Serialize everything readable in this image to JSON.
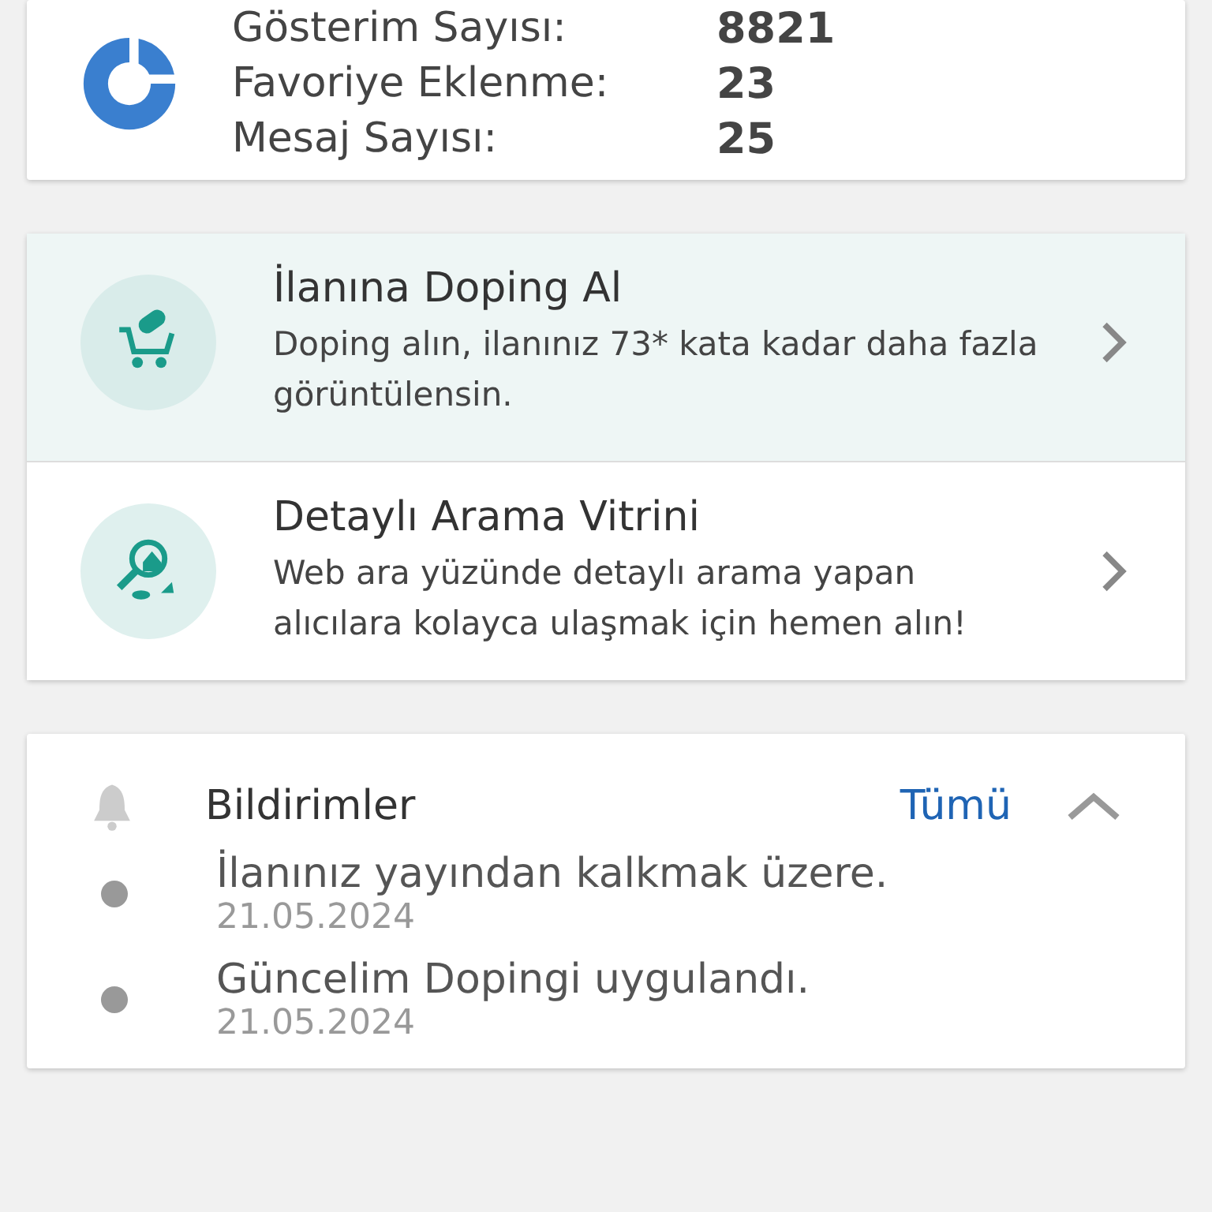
{
  "stats": [
    {
      "label": "Gösterim Sayısı:",
      "value": "8821"
    },
    {
      "label": "Favoriye Eklenme:",
      "value": "23"
    },
    {
      "label": "Mesaj Sayısı:",
      "value": "25"
    }
  ],
  "promotions": [
    {
      "kind": "doping",
      "title": "İlanına Doping Al",
      "text": "Doping alın, ilanınız 73* kata kadar daha fazla görüntülensin.",
      "highlighted": true
    },
    {
      "kind": "search",
      "title": "Detaylı Arama Vitrini",
      "text": "Web ara yüzünde detaylı arama yapan alıcılara kolayca ulaşmak için hemen alın!",
      "highlighted": false
    }
  ],
  "notifications": {
    "title": "Bildirimler",
    "link": "Tümü",
    "expanded": true,
    "items": [
      {
        "text": "İlanınız yayından kalkmak üzere.",
        "date": "21.05.2024"
      },
      {
        "text": "Güncelim Dopingi uygulandı.",
        "date": "21.05.2024"
      }
    ]
  }
}
